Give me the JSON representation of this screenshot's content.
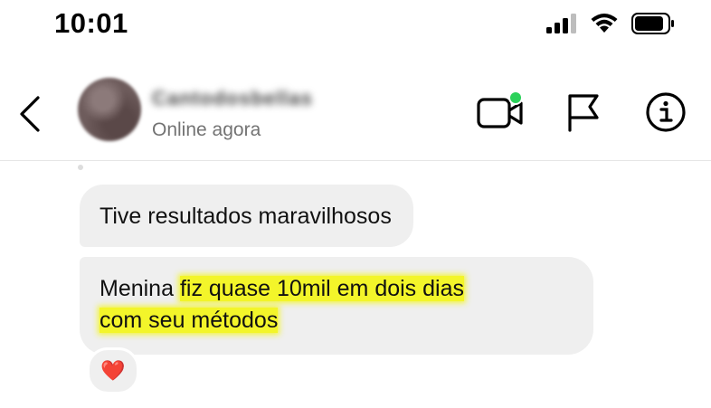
{
  "status_bar": {
    "time": "10:01"
  },
  "header": {
    "contact_name": "Cantodosbellas",
    "presence": "Online agora",
    "accent_online": "#2bd15a"
  },
  "messages": [
    {
      "text": "Tive resultados maravilhosos"
    },
    {
      "text_plain": "Menina ",
      "text_highlight_line1": "fiz quase 10mil em dois dias",
      "text_highlight_line2": "com seu métodos",
      "highlight_color": "#f3f52a",
      "reaction": "❤️"
    }
  ]
}
